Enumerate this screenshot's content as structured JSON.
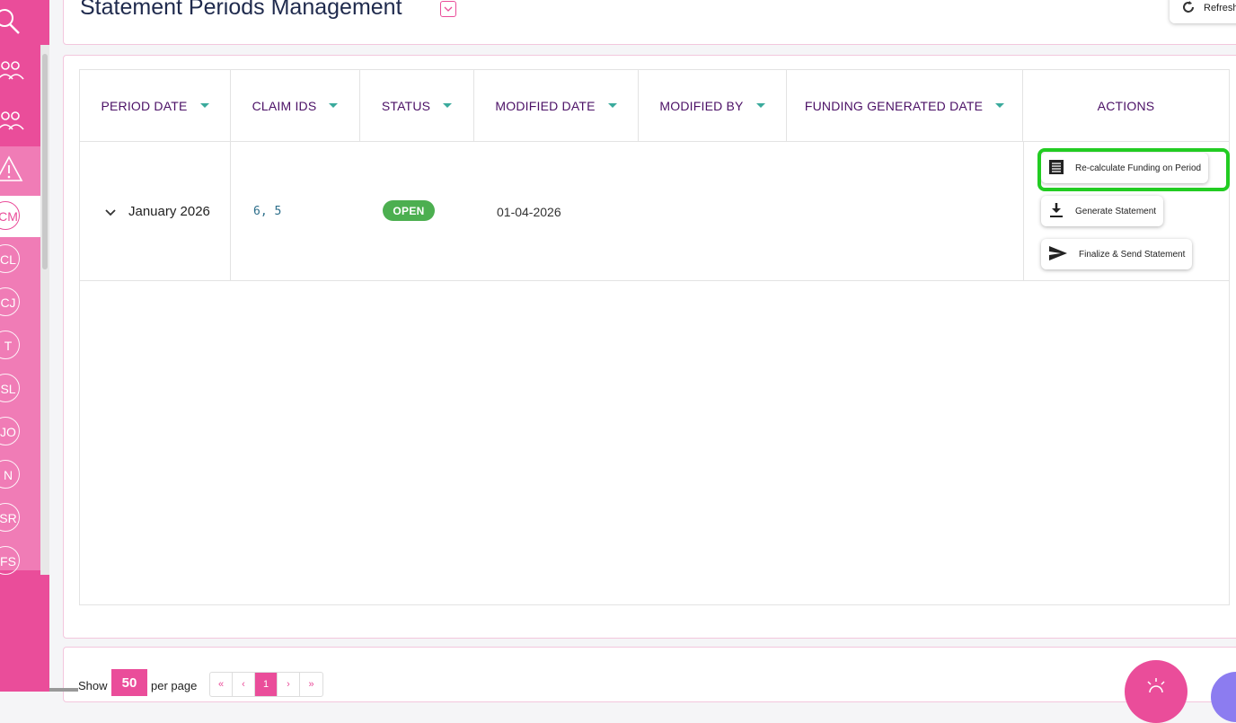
{
  "header": {
    "title": "Statement Periods Management",
    "refresh_label": "Refresh"
  },
  "sidebar": {
    "icons": [
      "search-icon",
      "users-icon",
      "users-icon",
      "warning-icon"
    ],
    "items": [
      {
        "label": "CM",
        "active": true
      },
      {
        "label": "CL"
      },
      {
        "label": "CJ"
      },
      {
        "label": "T"
      },
      {
        "label": "SL"
      },
      {
        "label": "JO"
      },
      {
        "label": "N"
      },
      {
        "label": "SR"
      },
      {
        "label": "FS"
      }
    ]
  },
  "table": {
    "columns": [
      "PERIOD DATE",
      "CLAIM IDS",
      "STATUS",
      "MODIFIED DATE",
      "MODIFIED BY",
      "FUNDING GENERATED DATE",
      "ACTIONS"
    ],
    "rows": [
      {
        "period_date": "January 2026",
        "claim_ids": "6, 5",
        "status": "OPEN",
        "modified_date": "01-04-2026",
        "modified_by": "",
        "funding_generated_date": "",
        "actions": [
          {
            "label": "Re-calculate Funding on Period",
            "icon": "document-icon"
          },
          {
            "label": "Generate Statement",
            "icon": "download-icon"
          },
          {
            "label": "Finalize & Send Statement",
            "icon": "send-icon"
          }
        ]
      }
    ]
  },
  "footer": {
    "show_label": "Show",
    "page_size": "50",
    "per_page_label": "per page",
    "pager": [
      "«",
      "‹",
      "1",
      "›",
      "»"
    ],
    "current_page": "1"
  },
  "colors": {
    "brand": "#ea4d9a",
    "status_open": "#4caf50",
    "header_text": "#4b1066",
    "highlight": "#22cc22"
  }
}
